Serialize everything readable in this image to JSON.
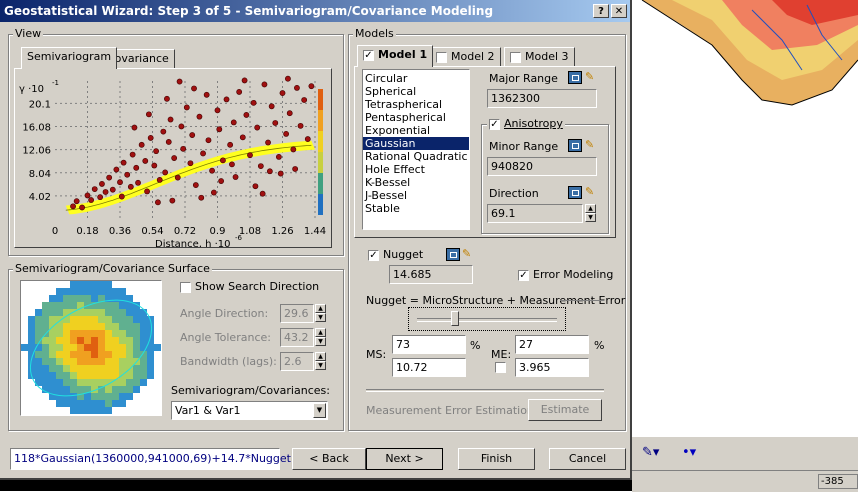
{
  "dialog": {
    "title": "Geostatistical Wizard: Step 3 of 5 - Semivariogram/Covariance Modeling",
    "help": "?",
    "close": "✕"
  },
  "view": {
    "label": "View",
    "tabs": [
      "Semivariogram",
      "Covariance"
    ],
    "chart_yunit": "γ ·10",
    "chart_yexp": "-1",
    "chart_xlabel": "Distance, h ·10",
    "chart_xexp": "-6"
  },
  "surface": {
    "label": "Semivariogram/Covariance Surface",
    "show_search": "Show Search Direction",
    "angle_dir_label": "Angle Direction:",
    "angle_dir_value": "29.6",
    "angle_tol_label": "Angle Tolerance:",
    "angle_tol_value": "43.2",
    "bandwidth_label": "Bandwidth (lags):",
    "bandwidth_value": "2.6",
    "semivar_label": "Semivariogram/Covariances:",
    "semivar_value": "Var1 & Var1"
  },
  "models": {
    "label": "Models",
    "tabs": [
      "Model 1",
      "Model 2",
      "Model 3"
    ],
    "types": [
      "Circular",
      "Spherical",
      "Tetraspherical",
      "Pentaspherical",
      "Exponential",
      "Gaussian",
      "Rational Quadratic",
      "Hole Effect",
      "K-Bessel",
      "J-Bessel",
      "Stable"
    ],
    "selected": "Gaussian",
    "major_range_label": "Major Range",
    "major_range_value": "1362300",
    "anisotropy_label": "Anisotropy",
    "minor_range_label": "Minor Range",
    "minor_range_value": "940820",
    "direction_label": "Direction",
    "direction_value": "69.1"
  },
  "nugget": {
    "label": "Nugget",
    "value": "14.685",
    "error_modeling": "Error Modeling",
    "equation": "Nugget = MicroStructure + Measurement Error",
    "ms_label": "MS:",
    "ms_pct": "73",
    "ms_value": "10.72",
    "me_label": "ME:",
    "me_pct": "27",
    "me_value": "3.965",
    "pct": "%",
    "slider_fraction": 0.73,
    "me_estimation": "Measurement Error Estimation",
    "estimate": "Estimate"
  },
  "footer": {
    "formula": "118*Gaussian(1360000,941000,69)+14.7*Nugget",
    "back": "< Back",
    "next": "Next >",
    "finish": "Finish",
    "cancel": "Cancel"
  },
  "statusbar": {
    "coord": "-385"
  },
  "chart_data": {
    "type": "scatter",
    "xlabel": "Distance, h ·10-6",
    "ylabel": "γ ·10-1",
    "xticks": [
      "0",
      "0.18",
      "0.36",
      "0.54",
      "0.72",
      "0.9",
      "1.08",
      "1.26",
      "1.44"
    ],
    "yticks": [
      "4.02",
      "8.04",
      "12.06",
      "16.08",
      "20.1"
    ],
    "xlim": [
      0,
      1.44
    ],
    "ylim": [
      0,
      24
    ],
    "model_curve": {
      "type": "gaussian",
      "nugget": 1.47,
      "sill": 11.8,
      "range": 1.36
    },
    "points": [
      [
        0.1,
        2.2
      ],
      [
        0.12,
        3.1
      ],
      [
        0.15,
        2.0
      ],
      [
        0.18,
        4.1
      ],
      [
        0.2,
        3.3
      ],
      [
        0.22,
        5.2
      ],
      [
        0.25,
        3.8
      ],
      [
        0.26,
        6.1
      ],
      [
        0.28,
        4.7
      ],
      [
        0.3,
        7.2
      ],
      [
        0.32,
        5.1
      ],
      [
        0.34,
        8.6
      ],
      [
        0.36,
        6.4
      ],
      [
        0.37,
        3.9
      ],
      [
        0.38,
        9.8
      ],
      [
        0.4,
        7.7
      ],
      [
        0.42,
        5.6
      ],
      [
        0.43,
        11.2
      ],
      [
        0.45,
        8.9
      ],
      [
        0.46,
        6.3
      ],
      [
        0.48,
        12.9
      ],
      [
        0.5,
        10.1
      ],
      [
        0.51,
        4.8
      ],
      [
        0.53,
        14.1
      ],
      [
        0.55,
        9.3
      ],
      [
        0.56,
        11.8
      ],
      [
        0.58,
        6.8
      ],
      [
        0.6,
        15.2
      ],
      [
        0.61,
        8.1
      ],
      [
        0.63,
        13.4
      ],
      [
        0.64,
        17.3
      ],
      [
        0.66,
        10.6
      ],
      [
        0.68,
        7.2
      ],
      [
        0.7,
        16.1
      ],
      [
        0.71,
        12.2
      ],
      [
        0.73,
        19.4
      ],
      [
        0.75,
        9.7
      ],
      [
        0.76,
        14.6
      ],
      [
        0.78,
        5.9
      ],
      [
        0.8,
        17.8
      ],
      [
        0.82,
        11.4
      ],
      [
        0.84,
        21.6
      ],
      [
        0.85,
        13.7
      ],
      [
        0.87,
        8.4
      ],
      [
        0.9,
        18.9
      ],
      [
        0.91,
        15.6
      ],
      [
        0.93,
        10.2
      ],
      [
        0.95,
        20.8
      ],
      [
        0.97,
        12.9
      ],
      [
        0.99,
        16.8
      ],
      [
        1.0,
        7.3
      ],
      [
        1.02,
        22.1
      ],
      [
        1.04,
        14.2
      ],
      [
        1.06,
        18.1
      ],
      [
        1.08,
        11.1
      ],
      [
        1.1,
        20.2
      ],
      [
        1.12,
        15.9
      ],
      [
        1.14,
        9.2
      ],
      [
        1.16,
        23.4
      ],
      [
        1.18,
        13.3
      ],
      [
        1.2,
        19.6
      ],
      [
        1.22,
        16.7
      ],
      [
        1.24,
        10.8
      ],
      [
        1.26,
        21.9
      ],
      [
        1.28,
        14.8
      ],
      [
        1.3,
        18.4
      ],
      [
        1.32,
        12.1
      ],
      [
        1.34,
        22.8
      ],
      [
        1.36,
        16.2
      ],
      [
        1.38,
        20.7
      ],
      [
        1.4,
        13.9
      ],
      [
        1.42,
        23.1
      ],
      [
        0.65,
        3.2
      ],
      [
        0.88,
        4.6
      ],
      [
        1.11,
        5.7
      ],
      [
        1.25,
        7.9
      ],
      [
        0.52,
        18.2
      ],
      [
        0.77,
        22.7
      ],
      [
        1.05,
        24.1
      ],
      [
        1.33,
        8.7
      ],
      [
        0.62,
        20.9
      ],
      [
        0.92,
        6.6
      ],
      [
        1.19,
        8.3
      ],
      [
        0.44,
        15.9
      ],
      [
        0.69,
        23.9
      ],
      [
        0.98,
        9.5
      ],
      [
        1.29,
        24.4
      ],
      [
        0.57,
        2.9
      ],
      [
        0.81,
        3.7
      ],
      [
        1.15,
        4.4
      ]
    ]
  }
}
